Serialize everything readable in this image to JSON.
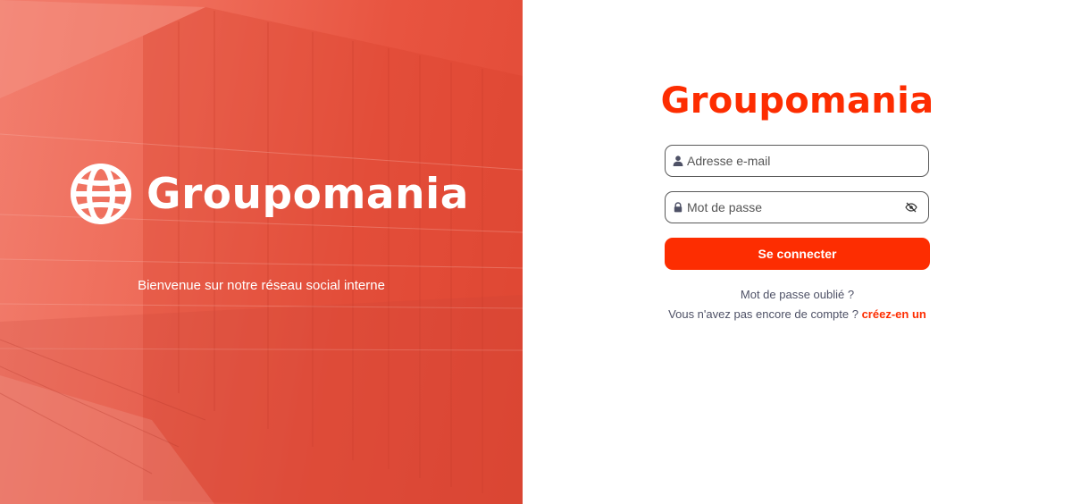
{
  "hero": {
    "brand_name": "Groupomania",
    "tagline": "Bienvenue sur notre réseau social interne",
    "logo_icon": "globe-icon"
  },
  "login": {
    "brand_name": "Groupomania",
    "email": {
      "placeholder": "Adresse e-mail",
      "value": "",
      "icon": "user-icon"
    },
    "password": {
      "placeholder": "Mot de passe",
      "value": "",
      "icon": "lock-icon",
      "toggle_icon": "eye-slash-icon"
    },
    "submit_label": "Se connecter",
    "forgot_label": "Mot de passe oublié ?",
    "signup_prompt": "Vous n'avez pas encore de compte ?",
    "signup_link": "créez-en un"
  },
  "colors": {
    "brand": "#fd2d01",
    "tertiary": "#4e5166",
    "hero_tint": "#e85440"
  }
}
